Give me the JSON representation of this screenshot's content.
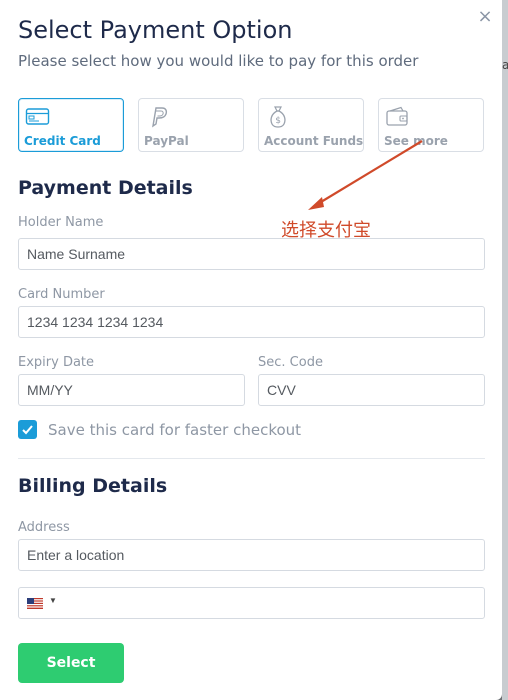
{
  "modal": {
    "title": "Select Payment Option",
    "subtitle": "Please select how you would like to pay for this order",
    "close_icon": "×"
  },
  "payment_methods": [
    {
      "label": "Credit Card",
      "icon": "credit-card-icon",
      "active": true
    },
    {
      "label": "PayPal",
      "icon": "paypal-icon",
      "active": false
    },
    {
      "label": "Account Funds",
      "icon": "money-bag-icon",
      "active": false
    },
    {
      "label": "See more",
      "icon": "wallet-icon",
      "active": false
    }
  ],
  "payment_details": {
    "title": "Payment Details",
    "holder_name_label": "Holder Name",
    "holder_name_placeholder": "Name Surname",
    "card_number_label": "Card Number",
    "card_number_placeholder": "1234 1234 1234 1234",
    "expiry_label": "Expiry Date",
    "expiry_placeholder": "MM/YY",
    "sec_code_label": "Sec. Code",
    "sec_code_placeholder": "CVV",
    "save_card_label": "Save this card for faster checkout",
    "save_card_checked": true
  },
  "billing_details": {
    "title": "Billing Details",
    "address_label": "Address",
    "address_placeholder": "Enter a location",
    "phone_country": "US"
  },
  "actions": {
    "select_label": "Select"
  },
  "annotation": {
    "text": "选择支付宝",
    "color": "#d04a2a"
  },
  "colors": {
    "accent": "#1b9cd8",
    "primary_button": "#2ecc71",
    "heading": "#1e2a4a"
  }
}
